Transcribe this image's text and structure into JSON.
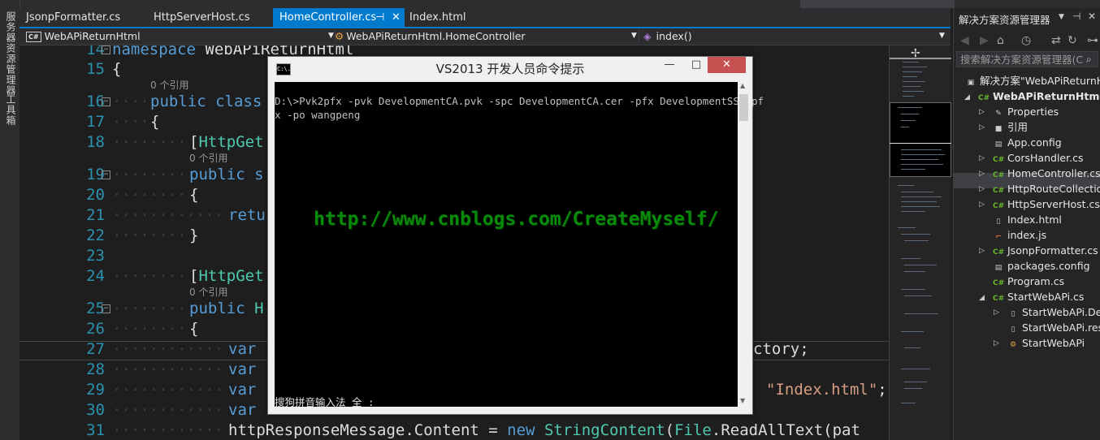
{
  "tabs": [
    {
      "label": "JsonpFormatter.cs"
    },
    {
      "label": "HttpServerHost.cs"
    },
    {
      "label": "HomeController.cs",
      "active": true
    },
    {
      "label": "Index.html"
    }
  ],
  "tab_pin": "⊣",
  "tab_close": "✕",
  "nav": {
    "project": "WebAPiReturnHtml",
    "class": "WebAPiReturnHtml.HomeController",
    "member": "index()"
  },
  "left_strip": [
    "服务器资源管理器",
    "工具箱"
  ],
  "code": {
    "lines": [
      "14",
      "15",
      "16",
      "17",
      "18",
      "19",
      "20",
      "21",
      "22",
      "23",
      "24",
      "25",
      "26",
      "27",
      "28",
      "29",
      "30",
      "31"
    ],
    "ref0": "0 个引用",
    "l14_kw": "namespace",
    "l14_name": " WebAPiReturnHtml",
    "l15": "{",
    "l16_kw": "public class",
    "l17": "{",
    "l18_a": "[",
    "l18_b": "HttpGet",
    "l19_kw": "public s",
    "l20": "{",
    "l21_kw": "retu",
    "l22": "}",
    "l24_a": "[",
    "l24_b": "HttpGet",
    "l25_kw": "public",
    "l25_ty": " H",
    "l26": "{",
    "l27_kw": "var",
    "l27_tail": "ctory;",
    "l28_kw": "var",
    "l29_kw": "var",
    "l29_str": "\"Index.html\"",
    "l29_tail": ";",
    "l30_kw": "var",
    "l30_tail": "g());",
    "l31_a": "httpResponseMessage.Content = ",
    "l31_kw": "new",
    "l31_ty": " StringContent",
    "l31_b": "(",
    "l31_ty2": "File",
    "l31_c": ".ReadAllText(pat"
  },
  "console": {
    "title": "VS2013 开发人员命令提示",
    "icon_text": "C:\\.",
    "line1": "D:\\>Pvk2pfx -pvk DevelopmentCA.pvk -spc DevelopmentCA.cer -pfx DevelopmentSSL.pf",
    "line2": "x -po wangpeng",
    "ime": "搜狗拼音输入法 全 :",
    "min": "—",
    "max": "□",
    "close": "✕",
    "up": "▲",
    "down": "▼"
  },
  "watermark": "http://www.cnblogs.com/CreateMyself/",
  "solution_explorer": {
    "title": "解决方案资源管理器",
    "search_placeholder": "搜索解决方案资源管理器(C",
    "items": [
      {
        "label": "解决方案\"WebAPiReturnHtml",
        "icon": "solution-icon"
      },
      {
        "label": "WebAPiReturnHtml",
        "icon": "project-icon"
      },
      {
        "label": "Properties",
        "icon": "wrench-icon"
      },
      {
        "label": "引用",
        "icon": "references-icon"
      },
      {
        "label": "App.config",
        "icon": "config-icon"
      },
      {
        "label": "CorsHandler.cs",
        "icon": "csharp-icon"
      },
      {
        "label": "HomeController.cs",
        "icon": "csharp-icon"
      },
      {
        "label": "HttpRouteCollectio",
        "icon": "csharp-icon"
      },
      {
        "label": "HttpServerHost.cs",
        "icon": "csharp-icon"
      },
      {
        "label": "Index.html",
        "icon": "html-icon"
      },
      {
        "label": "index.js",
        "icon": "js-icon"
      },
      {
        "label": "JsonpFormatter.cs",
        "icon": "csharp-icon"
      },
      {
        "label": "packages.config",
        "icon": "config-icon"
      },
      {
        "label": "Program.cs",
        "icon": "csharp-icon"
      },
      {
        "label": "StartWebAPi.cs",
        "icon": "csharp-icon"
      },
      {
        "label": "StartWebAPi.De",
        "icon": "csharp-icon"
      },
      {
        "label": "StartWebAPi.res",
        "icon": "resx-icon"
      },
      {
        "label": "StartWebAPi",
        "icon": "class-icon"
      }
    ]
  },
  "icons": {
    "cs_badge": "C#",
    "class_box": "C#"
  }
}
